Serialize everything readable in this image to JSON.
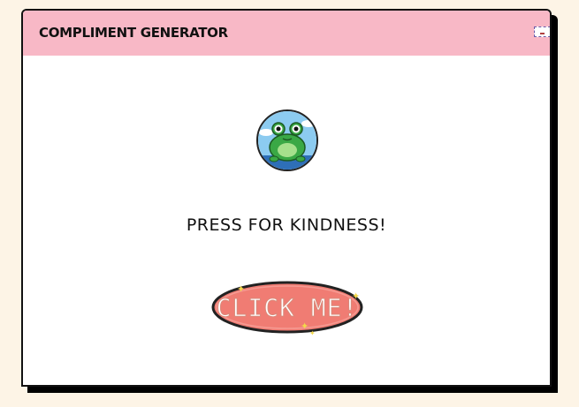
{
  "window": {
    "title": "COMPLIMENT GENERATOR",
    "controls": {
      "minimize_icon": "minimize-icon",
      "maximize_icon": "maximize-icon",
      "close_icon": "close-icon"
    }
  },
  "main": {
    "avatar_icon": "frog-icon",
    "prompt": "PRESS FOR KINDNESS!",
    "button_label": "CLICK ME!"
  },
  "colors": {
    "background": "#fdf4e6",
    "titlebar": "#f8b8c6",
    "window": "#ffffff",
    "button_fill": "#f07c73",
    "button_border": "#222222",
    "sparkle": "#f2d84a",
    "frog_green": "#3aa845",
    "sky_blue": "#8ccbf0"
  }
}
